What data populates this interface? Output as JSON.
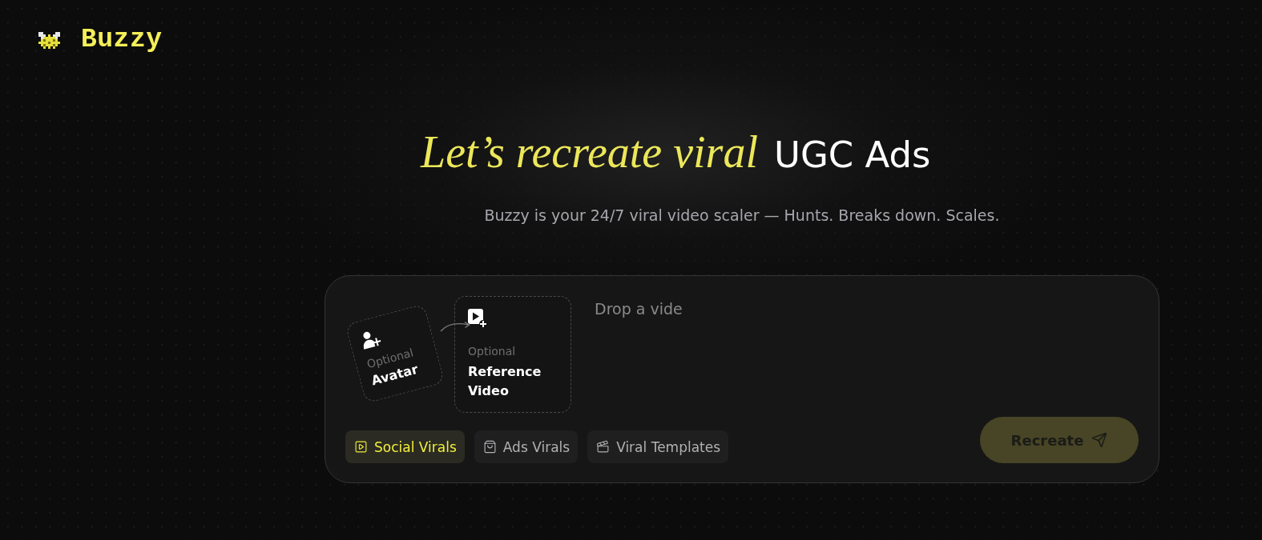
{
  "brand": {
    "name": "Buzzy"
  },
  "hero": {
    "title_highlight": "Let’s recreate viral",
    "title_rest": "UGC Ads",
    "subtitle": "Buzzy is your 24/7 viral video scaler — Hunts. Breaks down. Scales."
  },
  "composer": {
    "uploads": [
      {
        "kind": "avatar",
        "hint": "Optional",
        "label": "Avatar"
      },
      {
        "kind": "video",
        "hint": "Optional",
        "label": "Reference Video"
      }
    ],
    "prompt": {
      "placeholder": "Drop a vide"
    },
    "modes": [
      {
        "kind": "play",
        "label": "Social Virals",
        "selected": true
      },
      {
        "kind": "bag",
        "label": "Ads Virals",
        "selected": false
      },
      {
        "kind": "template",
        "label": "Viral Templates",
        "selected": false
      }
    ],
    "submit": {
      "label": "Recreate",
      "disabled": true
    }
  }
}
